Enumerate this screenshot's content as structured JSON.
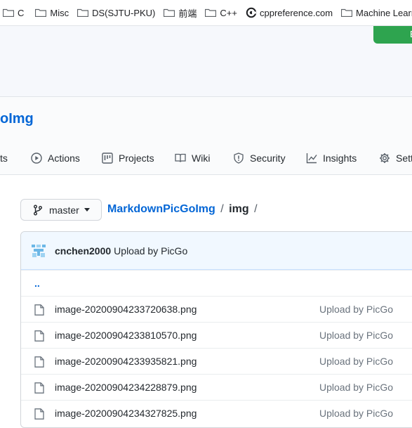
{
  "bookmarks": {
    "first": "C",
    "items": [
      {
        "label": "Misc",
        "icon": "folder-icon"
      },
      {
        "label": "DS(SJTU-PKU)",
        "icon": "folder-icon"
      },
      {
        "label": "前端",
        "icon": "folder-icon"
      },
      {
        "label": "C++",
        "icon": "folder-icon"
      },
      {
        "label": "cppreference.com",
        "icon": "cppreference-icon"
      },
      {
        "label": "Machine Learning",
        "icon": "folder-icon"
      }
    ]
  },
  "header": {
    "green_button_label": "E"
  },
  "repo": {
    "name": "oImg"
  },
  "tabs": [
    {
      "label": "ts",
      "icon": ""
    },
    {
      "label": "Actions",
      "icon": "play-icon"
    },
    {
      "label": "Projects",
      "icon": "project-icon"
    },
    {
      "label": "Wiki",
      "icon": "book-icon"
    },
    {
      "label": "Security",
      "icon": "shield-icon"
    },
    {
      "label": "Insights",
      "icon": "graph-icon"
    },
    {
      "label": "Setti",
      "icon": "gear-icon"
    }
  ],
  "branch": {
    "label": "master"
  },
  "breadcrumb": {
    "repo": "MarkdownPicGoImg",
    "sep1": "/",
    "dir": "img",
    "sep2": "/"
  },
  "commit": {
    "user": "cnchen2000",
    "message": "Upload by PicGo"
  },
  "files": {
    "up_link": "..",
    "rows": [
      {
        "name": "image-20200904233720638.png",
        "message": "Upload by PicGo"
      },
      {
        "name": "image-20200904233810570.png",
        "message": "Upload by PicGo"
      },
      {
        "name": "image-20200904233935821.png",
        "message": "Upload by PicGo"
      },
      {
        "name": "image-20200904234228879.png",
        "message": "Upload by PicGo"
      },
      {
        "name": "image-20200904234327825.png",
        "message": "Upload by PicGo"
      }
    ]
  },
  "colors": {
    "link": "#0366d6",
    "green": "#2ea44f",
    "commit_bg": "#f1f8ff"
  }
}
